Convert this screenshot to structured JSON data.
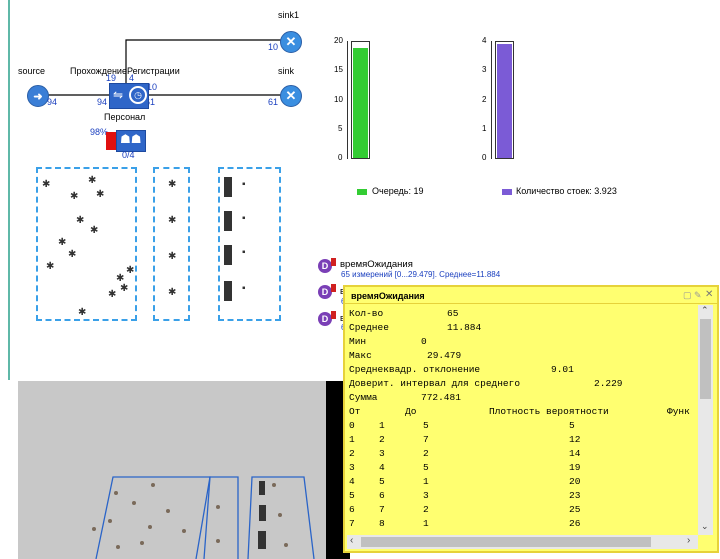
{
  "diagram": {
    "sink1": {
      "label": "sink1",
      "count": "10"
    },
    "source": {
      "label": "source",
      "count": "94"
    },
    "registration": {
      "label": "ПрохождениеРегистрации",
      "queue_count": "19",
      "in_count": "94",
      "proc_count": "4",
      "busy_count": "10",
      "out_count": "61"
    },
    "sink": {
      "label": "sink",
      "count": "61"
    },
    "staff": {
      "label": "Персонал",
      "percent": "98%",
      "ratio": "0/4"
    }
  },
  "charts": {
    "legend_queue": "Очередь: 19",
    "legend_desks": "Количество стоек: 3.923",
    "color_queue": "#33cc33",
    "color_desks": "#7b5bd6"
  },
  "chart_data": [
    {
      "type": "bar",
      "series": [
        {
          "name": "Очередь",
          "values": [
            19
          ]
        }
      ],
      "ylim": [
        0,
        20
      ],
      "yticks": [
        "0",
        "5",
        "10",
        "15",
        "20"
      ]
    },
    {
      "type": "bar",
      "series": [
        {
          "name": "Количество стоек",
          "values": [
            3.923
          ]
        }
      ],
      "ylim": [
        0,
        4
      ],
      "yticks": [
        "0",
        "1",
        "2",
        "3",
        "4"
      ]
    }
  ],
  "stats": {
    "items": [
      {
        "name": "времяОжидания",
        "summary": "65 измерений [0...29.479]. Среднее=11.884"
      },
      {
        "name": "в",
        "summary": "6"
      },
      {
        "name": "в",
        "summary": "6"
      }
    ]
  },
  "popup": {
    "title": "времяОжидания",
    "rows": [
      {
        "k": "Кол-во",
        "v": "65"
      },
      {
        "k": "Среднее",
        "v": "11.884"
      },
      {
        "k": "Мин",
        "v": "0"
      },
      {
        "k": "Макс",
        "v": "29.479"
      },
      {
        "k": "Среднеквадр. отклонение",
        "v": "9.01"
      },
      {
        "k": "Доверит. интервал для среднего",
        "v": "2.229"
      },
      {
        "k": "Сумма",
        "v": "772.481"
      }
    ],
    "headers": [
      "От",
      "До",
      "Плотность вероятности",
      "Функ"
    ],
    "hist": [
      [
        "0",
        "1",
        "5",
        "5"
      ],
      [
        "1",
        "2",
        "7",
        "12"
      ],
      [
        "2",
        "3",
        "2",
        "14"
      ],
      [
        "3",
        "4",
        "5",
        "19"
      ],
      [
        "4",
        "5",
        "1",
        "20"
      ],
      [
        "5",
        "6",
        "3",
        "23"
      ],
      [
        "6",
        "7",
        "2",
        "25"
      ],
      [
        "7",
        "8",
        "1",
        "26"
      ]
    ]
  }
}
